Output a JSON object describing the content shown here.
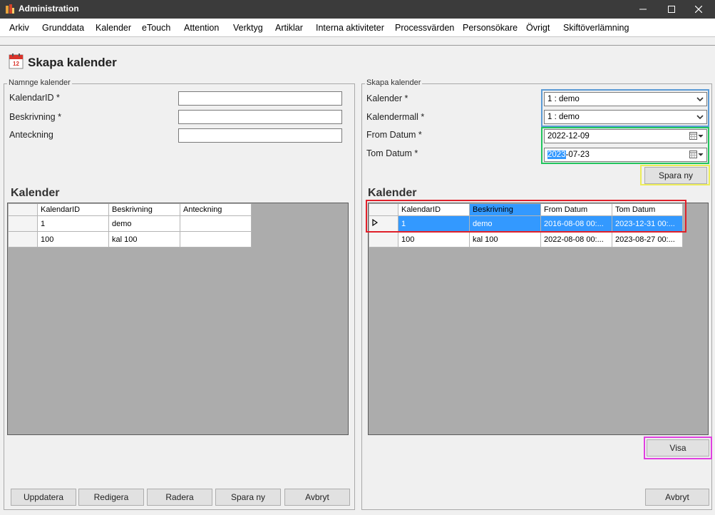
{
  "window": {
    "title": "Administration"
  },
  "menu": [
    "Arkiv",
    "Grunddata",
    "Kalender",
    "eTouch",
    "Attention",
    "Verktyg",
    "Artiklar",
    "Interna aktiviteter",
    "Processvärden",
    "Personsökare",
    "Övrigt",
    "Skiftöverlämning"
  ],
  "page": {
    "title": "Skapa kalender"
  },
  "left_panel": {
    "legend": "Namnge kalender",
    "fields": {
      "id_label": "KalendarID *",
      "desc_label": "Beskrivning *",
      "note_label": "Anteckning"
    },
    "grid_title": "Kalender",
    "grid": {
      "columns": [
        "KalendarID",
        "Beskrivning",
        "Anteckning"
      ],
      "rows": [
        [
          "1",
          "demo",
          ""
        ],
        [
          "100",
          "kal 100",
          ""
        ]
      ]
    },
    "buttons": {
      "update": "Uppdatera",
      "edit": "Redigera",
      "delete": "Radera",
      "save_new": "Spara ny",
      "cancel": "Avbryt"
    }
  },
  "right_panel": {
    "legend": "Skapa kalender",
    "fields": {
      "calendar_label": "Kalender *",
      "calendar_value": "1 : demo",
      "template_label": "Kalendermall *",
      "template_value": "1 : demo",
      "from_label": "From Datum *",
      "from_value": "2022-12-09",
      "to_label": "Tom Datum *",
      "to_value_selected": "2023",
      "to_value_rest": "-07-23"
    },
    "save_new_button": "Spara ny",
    "grid_title": "Kalender",
    "grid": {
      "columns": [
        "KalendarID",
        "Beskrivning",
        "From Datum",
        "Tom Datum"
      ],
      "rows": [
        [
          "1",
          "demo",
          "2016-08-08 00:...",
          "2023-12-31 00:..."
        ],
        [
          "100",
          "kal 100",
          "2022-08-08 00:...",
          "2023-08-27 00:..."
        ]
      ],
      "selected_row": 0
    },
    "show_button": "Visa",
    "cancel_button": "Avbryt"
  },
  "colors": {
    "titlebar": "#3b3b3b",
    "selection": "#3399ff",
    "highlight_blue": "#5b9bd5",
    "highlight_green": "#22c55e",
    "highlight_yellow": "#eded5a",
    "highlight_red": "#e0202a",
    "highlight_magenta": "#e040e0"
  }
}
